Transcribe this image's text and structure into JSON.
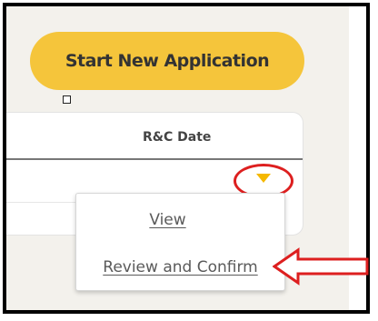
{
  "toolbar": {
    "start_new_application_label": "Start New Application"
  },
  "table": {
    "columns": [
      {
        "label": "R&C Date"
      }
    ]
  },
  "row_actions_menu": {
    "items": [
      {
        "label": "View"
      },
      {
        "label": "Review and Confirm"
      }
    ]
  },
  "annotations": {
    "highlight_color": "#dd1f1f",
    "highlight_target": "dropdown-caret",
    "arrow_target": "Review and Confirm"
  },
  "colors": {
    "accent": "#f5c53b",
    "caret": "#f5b800",
    "annotation": "#dd1f1f"
  },
  "icons": {
    "caret": "caret-down-icon",
    "arrow": "arrow-left-icon"
  }
}
